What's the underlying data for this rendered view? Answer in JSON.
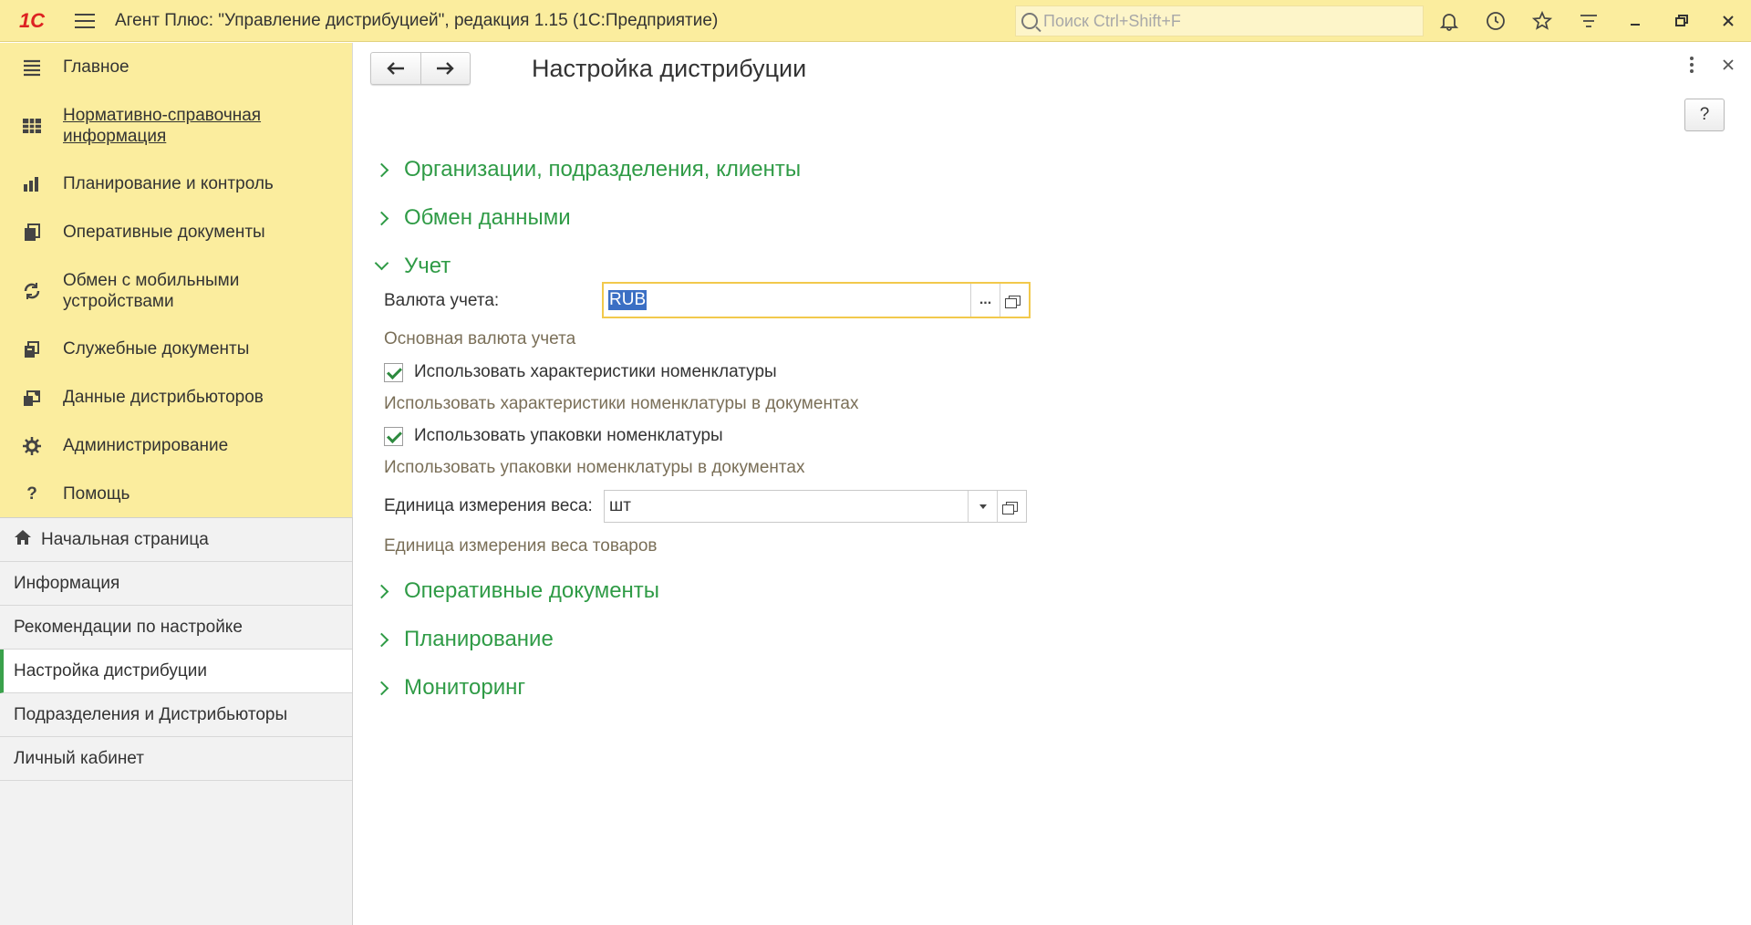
{
  "app": {
    "logo_text": "1С",
    "title": "Агент Плюс: \"Управление дистрибуцией\", редакция 1.15  (1С:Предприятие)",
    "search_placeholder": "Поиск Ctrl+Shift+F"
  },
  "top_icons": [
    "bell-icon",
    "history-icon",
    "star-icon",
    "settings-lines-icon",
    "minimize-icon",
    "restore-icon",
    "close-icon"
  ],
  "sections": [
    {
      "label": "Главное",
      "icon": "menu-lines-icon"
    },
    {
      "label": "Нормативно-справочная информация",
      "icon": "catalog-icon",
      "underline": true
    },
    {
      "label": "Планирование и контроль",
      "icon": "bar-chart-icon"
    },
    {
      "label": "Оперативные документы",
      "icon": "documents-icon"
    },
    {
      "label": "Обмен с мобильными устройствами",
      "icon": "sync-icon"
    },
    {
      "label": "Служебные документы",
      "icon": "service-docs-icon"
    },
    {
      "label": "Данные дистрибьюторов",
      "icon": "distributor-data-icon"
    },
    {
      "label": "Администрирование",
      "icon": "gear-icon"
    },
    {
      "label": "Помощь",
      "icon": "question-icon"
    }
  ],
  "windows": [
    {
      "label": "Начальная страница",
      "icon": "home-icon"
    },
    {
      "label": "Информация"
    },
    {
      "label": "Рекомендации по настройке"
    },
    {
      "label": "Настройка дистрибуции",
      "active": true
    },
    {
      "label": "Подразделения и Дистрибьюторы"
    },
    {
      "label": "Личный кабинет"
    }
  ],
  "form": {
    "title": "Настройка дистрибуции",
    "help_label": "?",
    "groups_collapsed_top": [
      "Организации, подразделения, клиенты",
      "Обмен данными"
    ],
    "expanded_group": "Учет",
    "currency_label": "Валюта учета:",
    "currency_value": "RUB",
    "currency_select_label": "...",
    "currency_hint": "Основная валюта учета",
    "use_characteristics_label": "Использовать характеристики номенклатуры",
    "use_characteristics_checked": true,
    "use_characteristics_hint": "Использовать характеристики номенклатуры в документах",
    "use_packages_label": "Использовать упаковки номенклатуры",
    "use_packages_checked": true,
    "use_packages_hint": "Использовать упаковки номенклатуры в документах",
    "weight_unit_label": "Единица измерения веса:",
    "weight_unit_value": "шт",
    "weight_unit_hint": "Единица измерения веса товаров",
    "groups_collapsed_bottom": [
      "Оперативные документы",
      "Планирование",
      "Мониторинг"
    ]
  },
  "colors": {
    "title_bar": "#fbed9e",
    "group_header": "#2f9b46",
    "hint_text": "#7a6f58",
    "focus_border": "#f2c94c",
    "active_marker": "#3aa14b"
  }
}
